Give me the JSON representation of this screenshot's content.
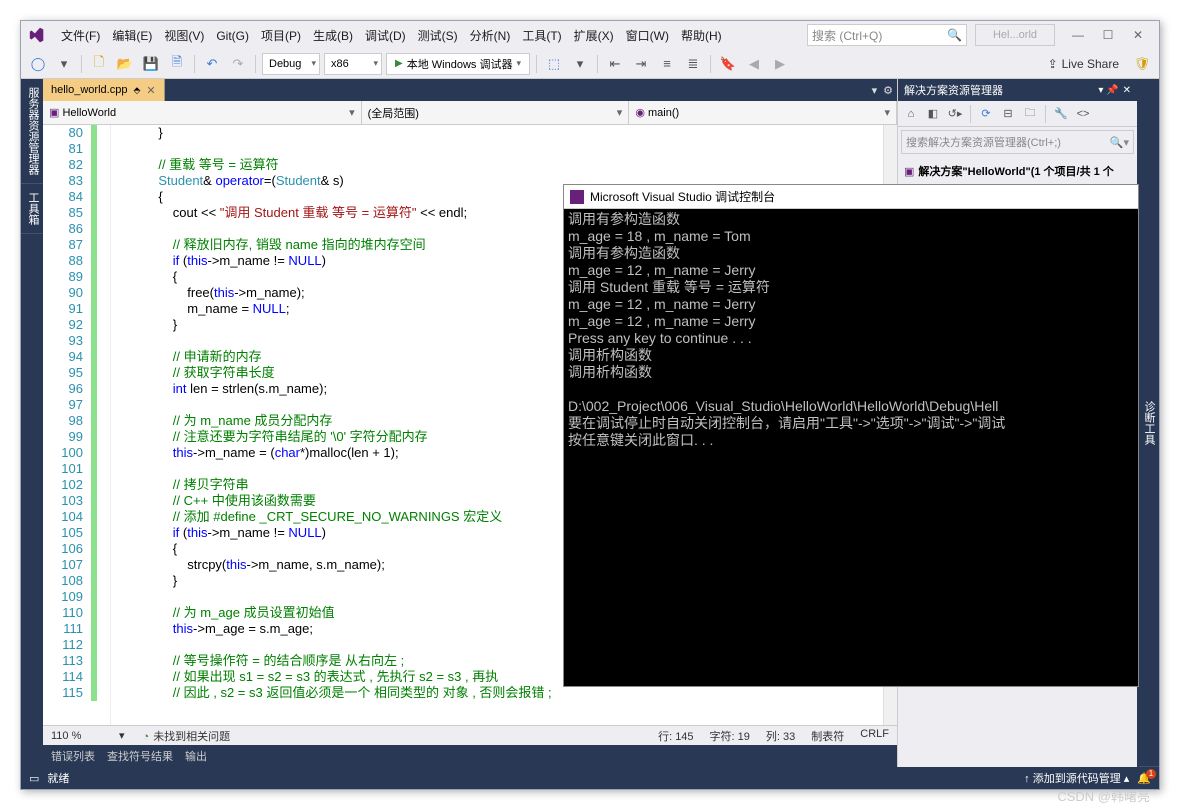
{
  "menus": [
    "文件(F)",
    "编辑(E)",
    "视图(V)",
    "Git(G)",
    "项目(P)",
    "生成(B)",
    "调试(D)",
    "测试(S)",
    "分析(N)",
    "工具(T)",
    "扩展(X)",
    "窗口(W)",
    "帮助(H)"
  ],
  "searchPlaceholder": "搜索 (Ctrl+Q)",
  "winTitle": "Hel...orld",
  "configCombo": "Debug",
  "platformCombo": "x86",
  "runLabel": "本地 Windows 调试器",
  "liveShare": "Live Share",
  "leftRail": [
    "服务器资源管理器",
    "工具箱"
  ],
  "rightRail": "诊断工具",
  "tabName": "hello_world.cpp",
  "nav1": "HelloWorld",
  "nav2": "(全局范围)",
  "nav3": "main()",
  "solHeader": "解决方案资源管理器",
  "solSearch": "搜索解决方案资源管理器(Ctrl+;)",
  "solRoot": "解决方案\"HelloWorld\"(1 个项目/共 1 个",
  "zoom": "110 %",
  "issuesText": "未找到相关问题",
  "statusCells": {
    "line": "行: 145",
    "char": "字符: 19",
    "col": "列: 33",
    "tabs": "制表符",
    "crlf": "CRLF"
  },
  "bottomTabs": [
    "错误列表",
    "查找符号结果",
    "输出"
  ],
  "sbReady": "就绪",
  "sbSource": "添加到源代码管理",
  "lineStart": 80,
  "code": [
    {
      "i": 0,
      "h": "            <span class='txt'>}</span>"
    },
    {
      "i": 0,
      "h": ""
    },
    {
      "i": 0,
      "h": "            <span class='cmt'>// 重载 等号 = 运算符</span>"
    },
    {
      "i": 0,
      "h": "            <span class='type'>Student</span><span class='txt'>&amp; </span><span class='kw'>operator</span><span class='txt'>=(</span><span class='type'>Student</span><span class='txt'>&amp; s)</span>"
    },
    {
      "i": 0,
      "h": "            <span class='txt'>{</span>"
    },
    {
      "i": 0,
      "h": "                <span class='txt'>cout &lt;&lt; </span><span class='str'>\"调用 Student 重载 等号 = 运算符\"</span><span class='txt'> &lt;&lt; endl;</span>"
    },
    {
      "i": 0,
      "h": ""
    },
    {
      "i": 0,
      "h": "                <span class='cmt'>// 释放旧内存, 销毁 name 指向的堆内存空间</span>"
    },
    {
      "i": 0,
      "h": "                <span class='kw'>if</span><span class='txt'> (</span><span class='kw'>this</span><span class='txt'>-&gt;m_name != </span><span class='kw'>NULL</span><span class='txt'>)</span>"
    },
    {
      "i": 0,
      "h": "                <span class='txt'>{</span>"
    },
    {
      "i": 0,
      "h": "                    <span class='txt'>free(</span><span class='kw'>this</span><span class='txt'>-&gt;m_name);</span>"
    },
    {
      "i": 0,
      "h": "                    <span class='txt'>m_name = </span><span class='kw'>NULL</span><span class='txt'>;</span>"
    },
    {
      "i": 0,
      "h": "                <span class='txt'>}</span>"
    },
    {
      "i": 0,
      "h": ""
    },
    {
      "i": 0,
      "h": "                <span class='cmt'>// 申请新的内存</span>"
    },
    {
      "i": 0,
      "h": "                <span class='cmt'>// 获取字符串长度</span>"
    },
    {
      "i": 0,
      "h": "                <span class='kw'>int</span><span class='txt'> len = strlen(s.m_name);</span>"
    },
    {
      "i": 0,
      "h": ""
    },
    {
      "i": 0,
      "h": "                <span class='cmt'>// 为 m_name 成员分配内存</span>"
    },
    {
      "i": 0,
      "h": "                <span class='cmt'>// 注意还要为字符串结尾的 '\\0' 字符分配内存</span>"
    },
    {
      "i": 0,
      "h": "                <span class='kw'>this</span><span class='txt'>-&gt;m_name = (</span><span class='kw'>char</span><span class='txt'>*)malloc(len + 1);</span>"
    },
    {
      "i": 0,
      "h": ""
    },
    {
      "i": 0,
      "h": "                <span class='cmt'>// 拷贝字符串</span>"
    },
    {
      "i": 0,
      "h": "                <span class='cmt'>// C++ 中使用该函数需要</span>"
    },
    {
      "i": 0,
      "h": "                <span class='cmt'>// 添加 #define _CRT_SECURE_NO_WARNINGS 宏定义</span>"
    },
    {
      "i": 0,
      "h": "                <span class='kw'>if</span><span class='txt'> (</span><span class='kw'>this</span><span class='txt'>-&gt;m_name != </span><span class='kw'>NULL</span><span class='txt'>)</span>"
    },
    {
      "i": 0,
      "h": "                <span class='txt'>{</span>"
    },
    {
      "i": 0,
      "h": "                    <span class='txt'>strcpy(</span><span class='kw'>this</span><span class='txt'>-&gt;m_name, s.m_name);</span>"
    },
    {
      "i": 0,
      "h": "                <span class='txt'>}</span>"
    },
    {
      "i": 0,
      "h": ""
    },
    {
      "i": 0,
      "h": "                <span class='cmt'>// 为 m_age 成员设置初始值</span>"
    },
    {
      "i": 0,
      "h": "                <span class='kw'>this</span><span class='txt'>-&gt;m_age = s.m_age;</span>"
    },
    {
      "i": 0,
      "h": ""
    },
    {
      "i": 0,
      "h": "                <span class='cmt'>// 等号操作符 = 的结合顺序是 从右向左 ;</span>"
    },
    {
      "i": 0,
      "h": "                <span class='cmt'>// 如果出现 s1 = s2 = s3 的表达式 , 先执行 s2 = s3 , 再执</span>"
    },
    {
      "i": 0,
      "h": "                <span class='cmt'>// 因此 , s2 = s3 返回值必须是一个 相同类型的 对象 , 否则会报错 ;</span>"
    }
  ],
  "console": {
    "title": "Microsoft Visual Studio 调试控制台",
    "lines": [
      "调用有参构造函数",
      "m_age = 18 , m_name = Tom",
      "调用有参构造函数",
      "m_age = 12 , m_name = Jerry",
      "调用 Student 重载 等号 = 运算符",
      "m_age = 12 , m_name = Jerry",
      "m_age = 12 , m_name = Jerry",
      "Press any key to continue . . .",
      "调用析构函数",
      "调用析构函数",
      "",
      "D:\\002_Project\\006_Visual_Studio\\HelloWorld\\HelloWorld\\Debug\\Hell",
      "要在调试停止时自动关闭控制台，请启用\"工具\"->\"选项\"->\"调试\"->\"调试",
      "按任意键关闭此窗口. . ."
    ]
  },
  "watermark": "CSDN @韩曙亮"
}
